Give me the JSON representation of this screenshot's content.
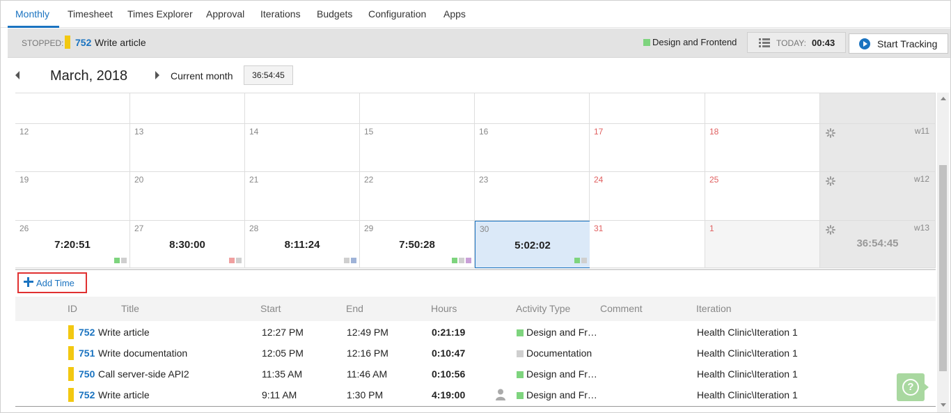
{
  "tabs": [
    "Monthly",
    "Timesheet",
    "Times Explorer",
    "Approval",
    "Iterations",
    "Budgets",
    "Configuration",
    "Apps"
  ],
  "tracker": {
    "stopped_label": "STOPPED:",
    "item_id": "752",
    "item_title": "Write article",
    "activity": "Design and Frontend",
    "activity_color": "#7ed47e",
    "today_label": "TODAY:",
    "today_value": "00:43",
    "start_label": "Start Tracking"
  },
  "month": {
    "title": "March, 2018",
    "current_label": "Current month",
    "total": "36:54:45"
  },
  "calendar": {
    "weeks": [
      {
        "days": [
          {
            "num": "",
            "total": ""
          },
          {
            "num": "",
            "total": ""
          },
          {
            "num": "",
            "total": ""
          },
          {
            "num": "",
            "total": ""
          },
          {
            "num": "",
            "total": ""
          },
          {
            "num": "",
            "total": ""
          },
          {
            "num": "",
            "total": ""
          }
        ],
        "week_label": "",
        "week_total": ""
      },
      {
        "days": [
          {
            "num": "12",
            "total": ""
          },
          {
            "num": "13",
            "total": ""
          },
          {
            "num": "14",
            "total": ""
          },
          {
            "num": "15",
            "total": ""
          },
          {
            "num": "16",
            "total": ""
          },
          {
            "num": "17",
            "total": ""
          },
          {
            "num": "18",
            "total": ""
          }
        ],
        "week_label": "w11",
        "week_total": ""
      },
      {
        "days": [
          {
            "num": "19",
            "total": ""
          },
          {
            "num": "20",
            "total": ""
          },
          {
            "num": "21",
            "total": ""
          },
          {
            "num": "22",
            "total": ""
          },
          {
            "num": "23",
            "total": ""
          },
          {
            "num": "24",
            "total": ""
          },
          {
            "num": "25",
            "total": ""
          }
        ],
        "week_label": "w12",
        "week_total": ""
      },
      {
        "days": [
          {
            "num": "26",
            "total": "7:20:51"
          },
          {
            "num": "27",
            "total": "8:30:00"
          },
          {
            "num": "28",
            "total": "8:11:24"
          },
          {
            "num": "29",
            "total": "7:50:28"
          },
          {
            "num": "30",
            "total": "5:02:02"
          },
          {
            "num": "31",
            "total": ""
          },
          {
            "num": "1",
            "total": ""
          }
        ],
        "week_label": "w13",
        "week_total": "36:54:45"
      }
    ],
    "activity_colors": {
      "design": "#7ed47e",
      "documentation": "#cfcfcf",
      "red": "#f0a0a0",
      "blue": "#9fb3d8",
      "purple": "#c9a0d8"
    }
  },
  "add_time_label": "Add Time",
  "table": {
    "headers": [
      "ID",
      "Title",
      "Start",
      "End",
      "Hours",
      "Activity Type",
      "Comment",
      "Iteration"
    ],
    "rows": [
      {
        "id": "752",
        "title": "Write article",
        "start": "12:27 PM",
        "end": "12:49 PM",
        "hours": "0:21:19",
        "activity": "Design and Fr…",
        "activity_color": "#7ed47e",
        "comment": "",
        "iteration": "Health Clinic\\Iteration 1"
      },
      {
        "id": "751",
        "title": "Write documentation",
        "start": "12:05 PM",
        "end": "12:16 PM",
        "hours": "0:10:47",
        "activity": "Documentation",
        "activity_color": "#cfcfcf",
        "comment": "",
        "iteration": "Health Clinic\\Iteration 1"
      },
      {
        "id": "750",
        "title": "Call server-side API2",
        "start": "11:35 AM",
        "end": "11:46 AM",
        "hours": "0:10:56",
        "activity": "Design and Fr…",
        "activity_color": "#7ed47e",
        "comment": "",
        "iteration": "Health Clinic\\Iteration 1"
      },
      {
        "id": "752",
        "title": "Write article",
        "start": "9:11 AM",
        "end": "1:30 PM",
        "hours": "4:19:00",
        "activity": "Design and Fr…",
        "activity_color": "#7ed47e",
        "comment": "",
        "iteration": "Health Clinic\\Iteration 1"
      }
    ]
  }
}
